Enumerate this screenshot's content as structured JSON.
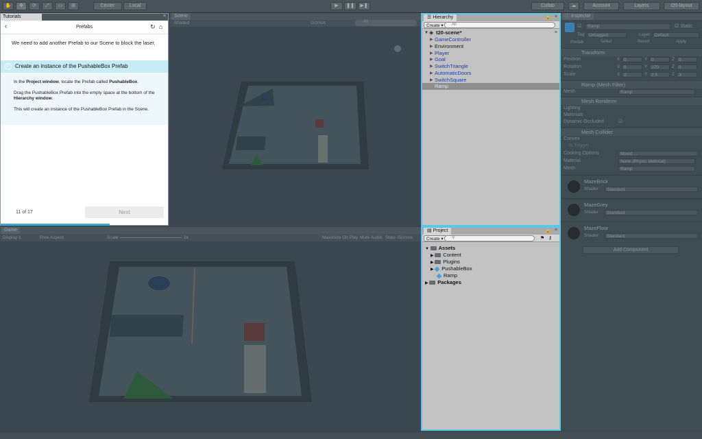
{
  "toolbar": {
    "pivot": "Center",
    "space": "Local",
    "collab": "Collab",
    "account": "Account",
    "layers": "Layers",
    "layout": "t20-layout"
  },
  "scene": {
    "tab": "Scene",
    "shading": "Shaded",
    "gizmos": "Gizmos",
    "search": "All"
  },
  "game": {
    "tab": "Game",
    "display": "Display 1",
    "aspect": "Free Aspect",
    "scale": "Scale",
    "scale_value": "2x",
    "maximize": "Maximize On Play",
    "mute": "Mute Audio",
    "stats": "Stats",
    "gizmos": "Gizmos"
  },
  "tutorials": {
    "tab": "Tutorials",
    "title": "Prefabs",
    "intro": "We need to add another Prefab to our Scene to block the laser.",
    "step_title": "Create an instance of the PushableBox Prefab",
    "p1_a": "In the ",
    "p1_b": "Project window",
    "p1_c": ", locate the Prefab called ",
    "p1_d": "PushableBox",
    "p1_e": ".",
    "p2_a": "Drag the PushableBox Prefab into the empty space at the bottom of the ",
    "p2_b": "Hierarchy window",
    "p2_c": ".",
    "p3": "This will create an instance of the PushableBox Prefab in the Scene.",
    "count": "11 of 17",
    "next": "Next"
  },
  "hierarchy": {
    "tab": "Hierarchy",
    "create": "Create",
    "search_placeholder": "All",
    "scene_name": "t20-scene*",
    "items": [
      {
        "label": "GameController",
        "color": "blue"
      },
      {
        "label": "Environment",
        "color": "black"
      },
      {
        "label": "Player",
        "color": "blue"
      },
      {
        "label": "Goal",
        "color": "blue"
      },
      {
        "label": "SwitchTriangle",
        "color": "blue"
      },
      {
        "label": "AutomaticDoors",
        "color": "blue"
      },
      {
        "label": "SwitchSquare",
        "color": "blue"
      },
      {
        "label": "Ramp",
        "color": "selected"
      }
    ]
  },
  "project": {
    "tab": "Project",
    "create": "Create",
    "items": [
      {
        "label": "Assets",
        "bold": true
      },
      {
        "label": "Content"
      },
      {
        "label": "Plugins"
      },
      {
        "label": "PushableBox"
      },
      {
        "label": "Ramp"
      },
      {
        "label": "Packages",
        "bold": true
      }
    ]
  },
  "inspector": {
    "tab": "Inspector",
    "name": "Ramp",
    "static": "Static",
    "tag_label": "Tag",
    "tag_value": "Untagged",
    "layer_label": "Layer",
    "layer_value": "Default",
    "prefab_label": "Prefab",
    "prefab_select": "Select",
    "prefab_revert": "Revert",
    "prefab_apply": "Apply",
    "transform": "Transform",
    "position": "Position",
    "rotation": "Rotation",
    "scale": "Scale",
    "pos": [
      "0",
      "0",
      "0"
    ],
    "rot": [
      "0",
      "270",
      "0"
    ],
    "scl": [
      "2",
      "2.5",
      "3"
    ],
    "axes": [
      "X",
      "Y",
      "Z"
    ],
    "mesh_filter": "Ramp (Mesh Filter)",
    "mesh_label": "Mesh",
    "mesh_value": "Ramp",
    "mesh_renderer": "Mesh Renderer",
    "lighting": "Lighting",
    "materials": "Materials",
    "dynamic_occluded": "Dynamic Occluded",
    "mesh_collider": "Mesh Collider",
    "convex": "Convex",
    "is_trigger": "Is Trigger",
    "cooking": "Cooking Options",
    "cooking_value": "Mixed ...",
    "material_label": "Material",
    "material_value": "None (Physic Material)",
    "mesh2_value": "Ramp",
    "materials_list": [
      {
        "name": "MazeBrick",
        "shader": "Standard"
      },
      {
        "name": "MazeGrey",
        "shader": "Standard"
      },
      {
        "name": "MazeFloor",
        "shader": "Standard"
      }
    ],
    "shader_label": "Shader",
    "add_component": "Add Component"
  }
}
